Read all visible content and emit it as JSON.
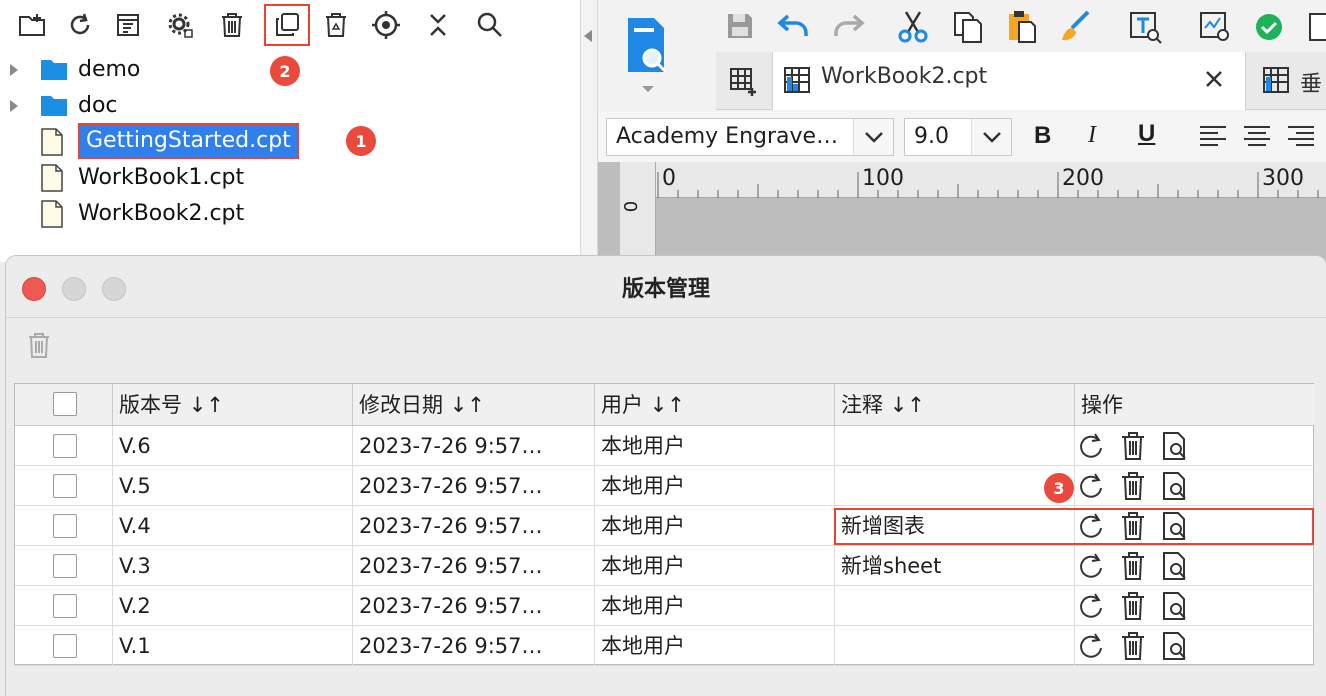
{
  "left_toolbar": {
    "icons": [
      "new-folder-icon",
      "refresh-icon",
      "template-icon",
      "settings-icon",
      "delete-icon",
      "version-copy-icon",
      "recycle-icon",
      "locate-icon",
      "collapse-icon",
      "search-icon"
    ]
  },
  "file_tree": {
    "items": [
      {
        "label": "demo",
        "type": "folder"
      },
      {
        "label": "doc",
        "type": "folder"
      },
      {
        "label": "GettingStarted.cpt",
        "type": "file",
        "selected": true
      },
      {
        "label": "WorkBook1.cpt",
        "type": "file"
      },
      {
        "label": "WorkBook2.cpt",
        "type": "file"
      }
    ]
  },
  "badges": {
    "b1": "1",
    "b2": "2",
    "b3": "3"
  },
  "designer": {
    "tab_label": "WorkBook2.cpt",
    "second_tab_label": "垂",
    "font_name": "Academy Engrave…",
    "font_size": "9.0",
    "bold": "B",
    "italic": "I",
    "underline": "U",
    "ruler": {
      "t0": "0",
      "t100": "100",
      "t200": "200",
      "t300": "300",
      "v0": "0"
    }
  },
  "dialog": {
    "title": "版本管理",
    "columns": [
      "版本号",
      "修改日期",
      "用户",
      "注释",
      "操作"
    ],
    "sort_glyph": "↓↑",
    "rows": [
      {
        "version": "V.6",
        "date": "2023-7-26 9:57…",
        "user": "本地用户",
        "note": ""
      },
      {
        "version": "V.5",
        "date": "2023-7-26 9:57…",
        "user": "本地用户",
        "note": ""
      },
      {
        "version": "V.4",
        "date": "2023-7-26 9:57…",
        "user": "本地用户",
        "note": "新增图表"
      },
      {
        "version": "V.3",
        "date": "2023-7-26 9:57…",
        "user": "本地用户",
        "note": "新增sheet"
      },
      {
        "version": "V.2",
        "date": "2023-7-26 9:57…",
        "user": "本地用户",
        "note": ""
      },
      {
        "version": "V.1",
        "date": "2023-7-26 9:57…",
        "user": "本地用户",
        "note": ""
      }
    ]
  },
  "colors": {
    "highlight": "#ea4335",
    "selection": "#2f80ed",
    "folder": "#1a8fe3"
  }
}
